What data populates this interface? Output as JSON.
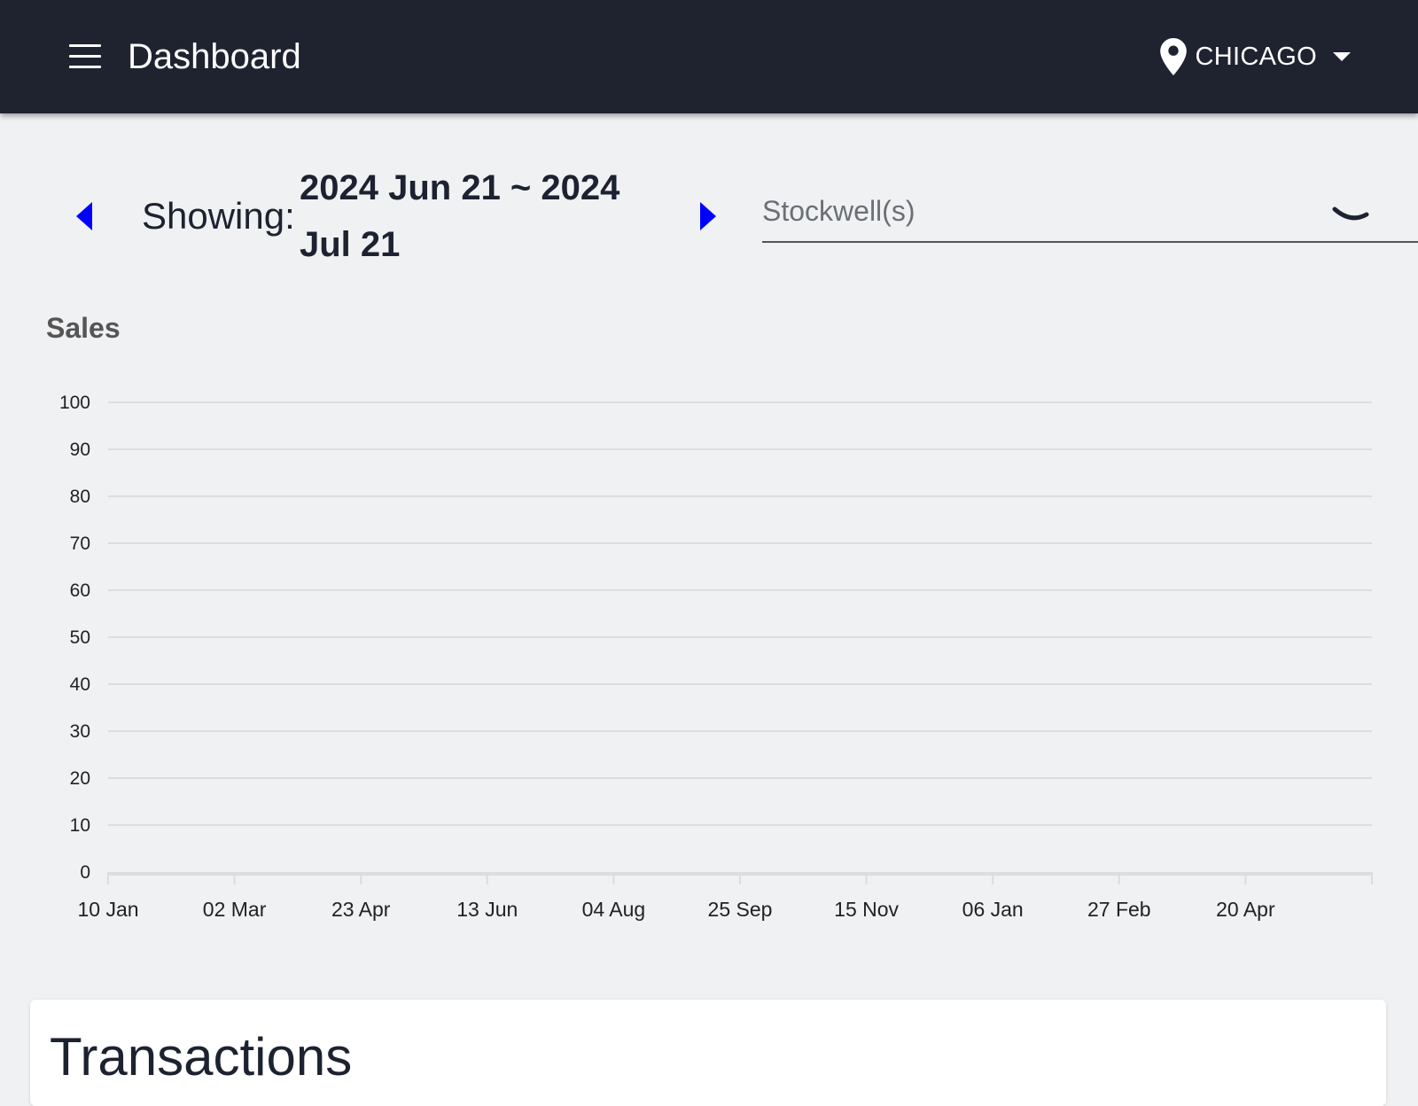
{
  "header": {
    "title": "Dashboard",
    "location": "CHICAGO",
    "icons": [
      "menu-icon",
      "location-pin-icon",
      "caret-down-icon"
    ]
  },
  "date_nav": {
    "showing_label": "Showing:",
    "range_line1": "2024 Jun 21 ~ 2024",
    "range_line2": "Jul 21",
    "arrow_color": "#0000ff"
  },
  "stockwell": {
    "placeholder": "Stockwell(s)",
    "value": ""
  },
  "sales_chart": {
    "title": "Sales"
  },
  "chart_data": {
    "type": "line",
    "title": "Sales",
    "xlabel": "",
    "ylabel": "",
    "ylim": [
      0,
      100
    ],
    "y_ticks": [
      0,
      10,
      20,
      30,
      40,
      50,
      60,
      70,
      80,
      90,
      100
    ],
    "x_tick_labels": [
      "10 Jan",
      "02 Mar",
      "23 Apr",
      "13 Jun",
      "04 Aug",
      "25 Sep",
      "15 Nov",
      "06 Jan",
      "27 Feb",
      "20 Apr"
    ],
    "grid": true,
    "series": []
  },
  "transactions": {
    "title": "Transactions"
  }
}
